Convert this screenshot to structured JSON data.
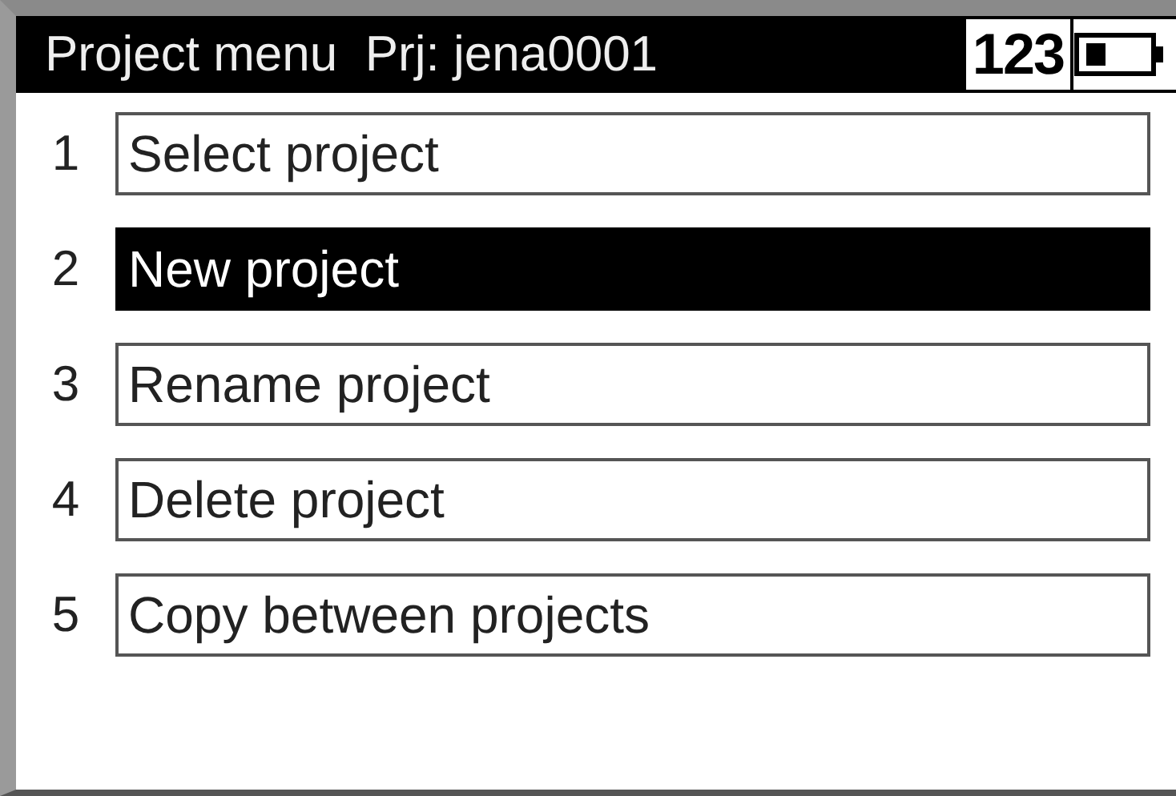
{
  "title_bar": {
    "title": "Project menu  Prj: jena0001",
    "input_mode": "123"
  },
  "menu": [
    {
      "number": "1",
      "label": "Select project",
      "selected": false
    },
    {
      "number": "2",
      "label": "New project",
      "selected": true
    },
    {
      "number": "3",
      "label": "Rename project",
      "selected": false
    },
    {
      "number": "4",
      "label": "Delete project",
      "selected": false
    },
    {
      "number": "5",
      "label": "Copy between projects",
      "selected": false
    }
  ]
}
